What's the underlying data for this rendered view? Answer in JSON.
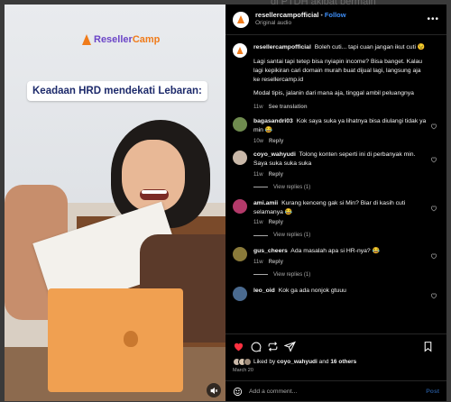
{
  "backdrop": {
    "text": "di PTDH akibat bermain"
  },
  "media": {
    "logo": {
      "text_a": "Reseller",
      "text_b": "Camp"
    },
    "overlay_caption": "Keadaan HRD mendekati Lebaran:",
    "mute_icon": "speaker-muted-icon"
  },
  "header": {
    "username": "resellercampofficial",
    "separator": "•",
    "follow_label": "Follow",
    "audio": "Original audio",
    "more_icon": "more-options-icon"
  },
  "caption": {
    "username": "resellercampofficial",
    "line1": "Boleh cuti... tapi cuan jangan ikut cuti 😉",
    "line2": "Lagi santai tapi tetep bisa nyiapin income? Bisa banget. Kalau lagi kepikiran cari domain murah buat dijual lagi, langsung aja ke resellercamp.id",
    "line3": "Modal tipis, jalanin dari mana aja, tinggal ambil peluangnya",
    "time": "11w",
    "see_translation": "See translation"
  },
  "comments": [
    {
      "username": "bagasandri03",
      "text": "Kok saya suka ya lihatnya bisa diulangi tidak ya min 😂",
      "time": "10w",
      "reply": "Reply",
      "view_replies": "",
      "avatar_color": "#6f8b4f"
    },
    {
      "username": "coyo_wahyudi",
      "text": "Tolong konten seperti ini di perbanyak min. Saya suka suka suka",
      "time": "11w",
      "reply": "Reply",
      "view_replies": "View replies (1)",
      "avatar_color": "#c9b8a8"
    },
    {
      "username": "ami.amii",
      "text": "Kurang kenceng gak si Min? Biar di kasih cuti selamanya 😂",
      "time": "11w",
      "reply": "Reply",
      "view_replies": "View replies (1)",
      "avatar_color": "#b33a6a"
    },
    {
      "username": "gus_cheers",
      "text": "Ada masalah apa si HR-nya? 😂",
      "time": "11w",
      "reply": "Reply",
      "view_replies": "View replies (1)",
      "avatar_color": "#8a7a3a"
    },
    {
      "username": "leo_oid",
      "text": "Kok ga ada nonjok gtuuu",
      "time": "",
      "reply": "",
      "view_replies": "",
      "avatar_color": "#4a6a8f"
    }
  ],
  "actions": {
    "icons": [
      "heart-filled-icon",
      "comment-icon",
      "repost-icon",
      "share-icon",
      "bookmark-icon"
    ],
    "heart_color": "#ff3040",
    "likes_prefix": "Liked by",
    "likes_user": "coyo_wahyudi",
    "likes_and": "and",
    "likes_others": "16 others",
    "date": "March 20"
  },
  "add_comment": {
    "placeholder": "Add a comment...",
    "post_label": "Post",
    "emoji_icon": "emoji-icon"
  }
}
